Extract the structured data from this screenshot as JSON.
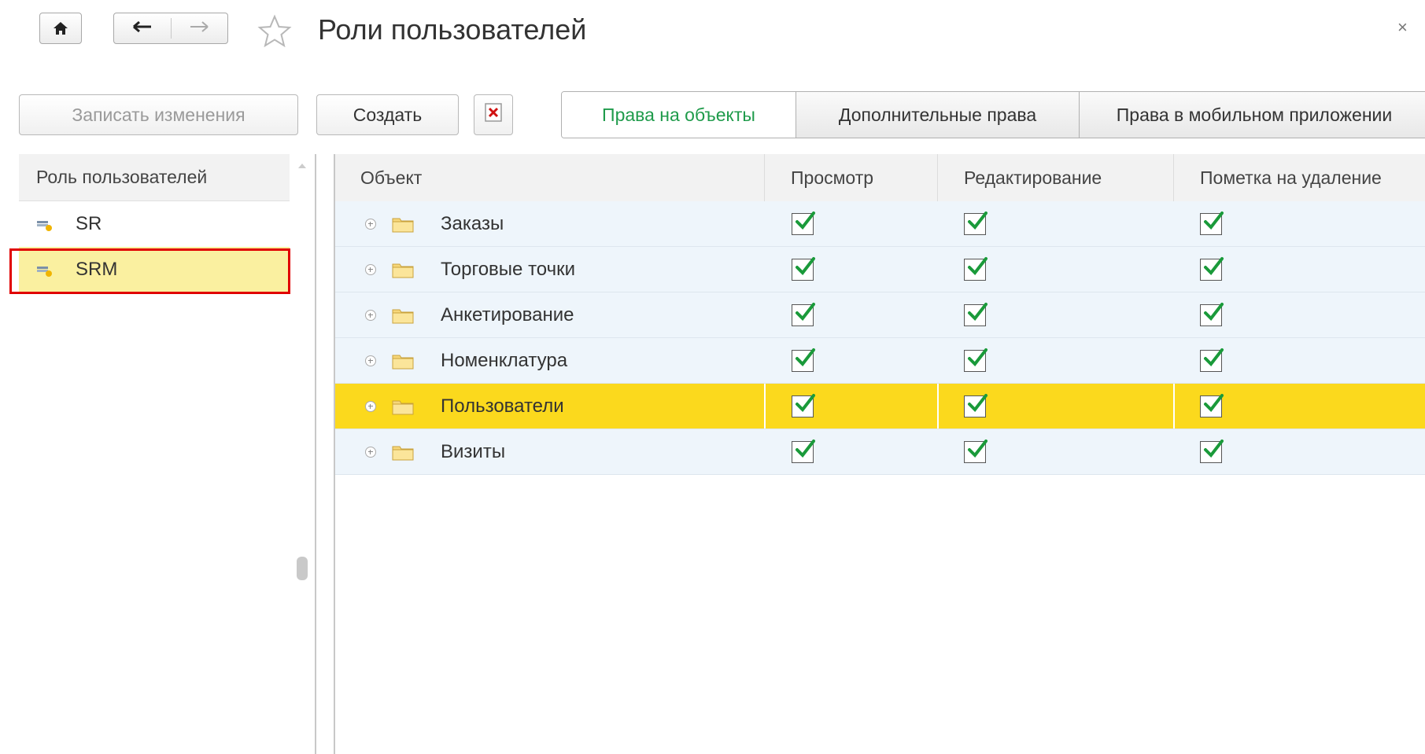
{
  "window": {
    "title": "Роли пользователей",
    "close_label": "×",
    "icons": {
      "home": "home-icon",
      "back": "arrow-left-icon",
      "forward": "arrow-right-icon",
      "favorite": "star-icon"
    }
  },
  "toolbar": {
    "save_label": "Записать изменения",
    "create_label": "Создать",
    "delete_icon": "delete-icon"
  },
  "tabs": [
    {
      "label": "Права на объекты",
      "active": true
    },
    {
      "label": "Дополнительные права",
      "active": false
    },
    {
      "label": "Права в мобильном приложении",
      "active": false
    }
  ],
  "roles": {
    "header": "Роль пользователей",
    "items": [
      {
        "label": "SR",
        "selected": false
      },
      {
        "label": "SRM",
        "selected": true
      }
    ]
  },
  "rights": {
    "columns": [
      "Объект",
      "Просмотр",
      "Редактирование",
      "Пометка на удаление"
    ],
    "rows": [
      {
        "object": "Заказы",
        "view": true,
        "edit": true,
        "delete_mark": true,
        "selected": false
      },
      {
        "object": "Торговые точки",
        "view": true,
        "edit": true,
        "delete_mark": true,
        "selected": false
      },
      {
        "object": "Анкетирование",
        "view": true,
        "edit": true,
        "delete_mark": true,
        "selected": false
      },
      {
        "object": "Номенклатура",
        "view": true,
        "edit": true,
        "delete_mark": true,
        "selected": false
      },
      {
        "object": "Пользователи",
        "view": true,
        "edit": true,
        "delete_mark": true,
        "selected": true
      },
      {
        "object": "Визиты",
        "view": true,
        "edit": true,
        "delete_mark": true,
        "selected": false
      }
    ]
  },
  "colors": {
    "accent_tab": "#1f9b4b",
    "row_selected": "#fbd91d",
    "role_selected": "#faf0a0",
    "check": "#1a9a3a",
    "highlight": "#e00000"
  }
}
